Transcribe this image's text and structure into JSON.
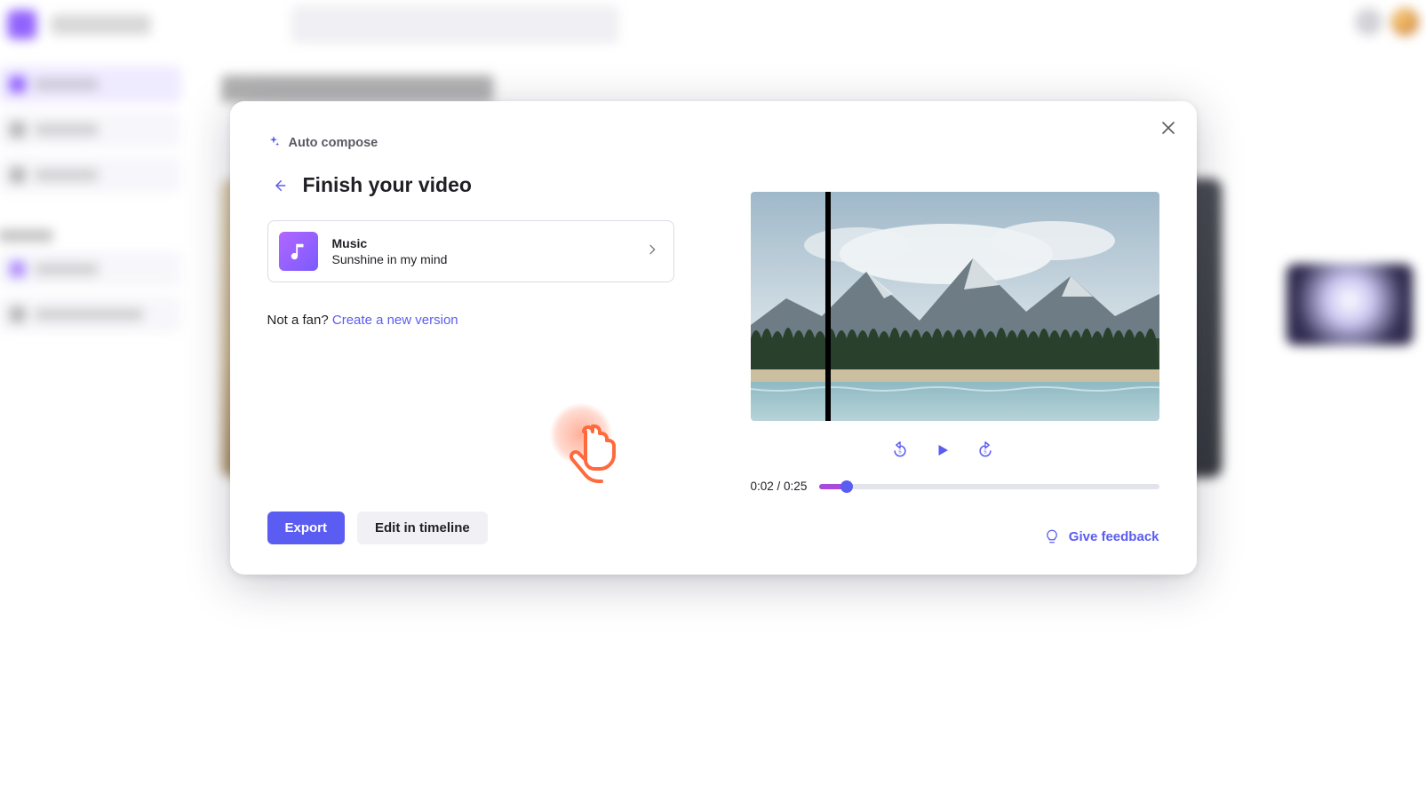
{
  "modal": {
    "auto_compose_label": "Auto compose",
    "title": "Finish your video",
    "music_card": {
      "label": "Music",
      "name": "Sunshine in my mind"
    },
    "not_a_fan": "Not a fan? ",
    "create_new_version": "Create a new version",
    "export_label": "Export",
    "edit_in_timeline_label": "Edit in timeline",
    "give_feedback_label": "Give feedback",
    "playback": {
      "current": "0:02",
      "total": "0:25",
      "progress_pct": 8
    }
  }
}
